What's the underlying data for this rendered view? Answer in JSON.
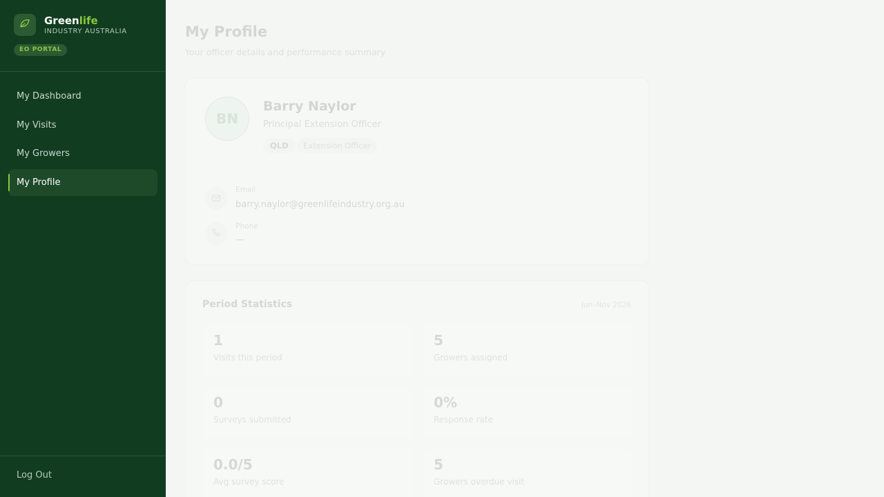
{
  "brand": {
    "name_part1": "Green",
    "name_part2": "life",
    "subtitle": "INDUSTRY AUSTRALIA",
    "portal_badge": "EO PORTAL",
    "logo_icon": "leaf-icon",
    "accent_color": "#8ac83f",
    "sidebar_color": "#113c20"
  },
  "nav": {
    "items": [
      {
        "label": "My Dashboard",
        "active": false
      },
      {
        "label": "My Visits",
        "active": false
      },
      {
        "label": "My Growers",
        "active": false
      },
      {
        "label": "My Profile",
        "active": true
      }
    ],
    "logout_label": "Log Out"
  },
  "page": {
    "title": "My Profile",
    "subtitle": "Your officer details and performance summary"
  },
  "profile": {
    "initials": "BN",
    "name": "Barry Naylor",
    "role": "Principal Extension Officer",
    "state": "QLD",
    "type": "Extension Officer",
    "email_label": "Email",
    "email": "barry.naylor@greenlifeindustry.org.au",
    "email_icon": "mail-icon",
    "phone_label": "Phone",
    "phone": "—",
    "phone_icon": "phone-icon"
  },
  "stats": {
    "title": "Period Statistics",
    "period": "Jun–Nov 2026",
    "items": [
      {
        "value": "1",
        "label": "Visits this period"
      },
      {
        "value": "5",
        "label": "Growers assigned"
      },
      {
        "value": "0",
        "label": "Surveys submitted"
      },
      {
        "value": "0%",
        "label": "Response rate"
      },
      {
        "value": "0.0/5",
        "label": "Avg survey score"
      },
      {
        "value": "5",
        "label": "Growers overdue visit"
      }
    ]
  }
}
